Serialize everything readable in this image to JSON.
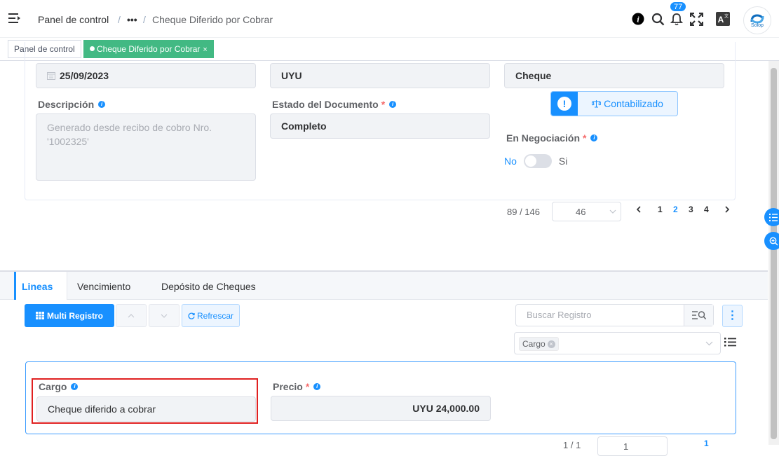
{
  "header": {
    "breadcrumb": [
      "Panel de control",
      "•••",
      "Cheque Diferido por Cobrar"
    ],
    "separator": "/",
    "notification_count": "77",
    "logo_text": "Solop"
  },
  "tags": {
    "home": "Panel de control",
    "active": "Cheque Diferido por Cobrar",
    "close": "×"
  },
  "form": {
    "date_value": "25/09/2023",
    "currency_value": "UYU",
    "type_value": "Cheque",
    "description_label": "Descripción",
    "description_value": "Generado desde recibo de cobro Nro. '1002325'",
    "doc_status_label": "Estado del Documento",
    "doc_status_value": "Completo",
    "status_button_label": "Contabilizado",
    "negotiation_label": "En Negociación",
    "switch_no": "No",
    "switch_yes": "Si",
    "required_mark": "*"
  },
  "pagination": {
    "record_position": "89 / 146",
    "page_select": "46",
    "pages": [
      "1",
      "2",
      "3",
      "4"
    ],
    "active_page": "2"
  },
  "tabs": [
    "Lineas",
    "Vencimiento",
    "Depósito de Cheques"
  ],
  "toolbar": {
    "multi_registro": "Multi Registro",
    "refrescar": "Refrescar",
    "search_placeholder": "Buscar Registro",
    "kebab": "⋮"
  },
  "filter": {
    "chip": "Cargo"
  },
  "line": {
    "cargo_label": "Cargo",
    "cargo_value": "Cheque diferido a cobrar",
    "precio_label": "Precio",
    "precio_value": "UYU 24,000.00"
  },
  "bottom_pager": {
    "record_position": "1 / 1",
    "page_select": "1",
    "page": "1"
  },
  "colors": {
    "primary": "#1890ff",
    "success_tag": "#42b983",
    "highlight": "#e02020"
  }
}
